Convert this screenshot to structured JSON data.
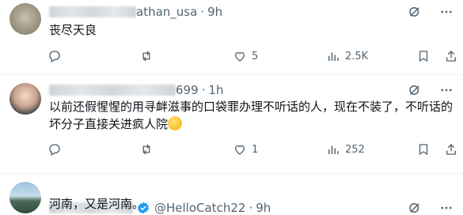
{
  "tweets": [
    {
      "handle_tail": "athan_usa",
      "time": "9h",
      "text": "丧尽天良",
      "replies": "",
      "retweets": "",
      "likes": "5",
      "views": "2.5K"
    },
    {
      "handle_tail": "699",
      "time": "1h",
      "text_line1": "以前还假惺惺的用寻衅滋事的口袋罪办理不听话的人，现在不装了，不听话的",
      "text_line2": "坏分子直接关进疯人院",
      "replies": "",
      "retweets": "",
      "likes": "1",
      "views": "252"
    },
    {
      "handle": "@HelloCatch22",
      "time": "9h",
      "text": "河南，又是河南。"
    }
  ],
  "separator": "·",
  "colors": {
    "secondary": "#536471",
    "verified": "#1d9bf0",
    "divider": "#eff3f4"
  },
  "icons": [
    "reply-icon",
    "retweet-icon",
    "like-icon",
    "views-icon",
    "bookmark-icon",
    "share-icon",
    "grok-icon",
    "more-icon",
    "verified-icon"
  ]
}
